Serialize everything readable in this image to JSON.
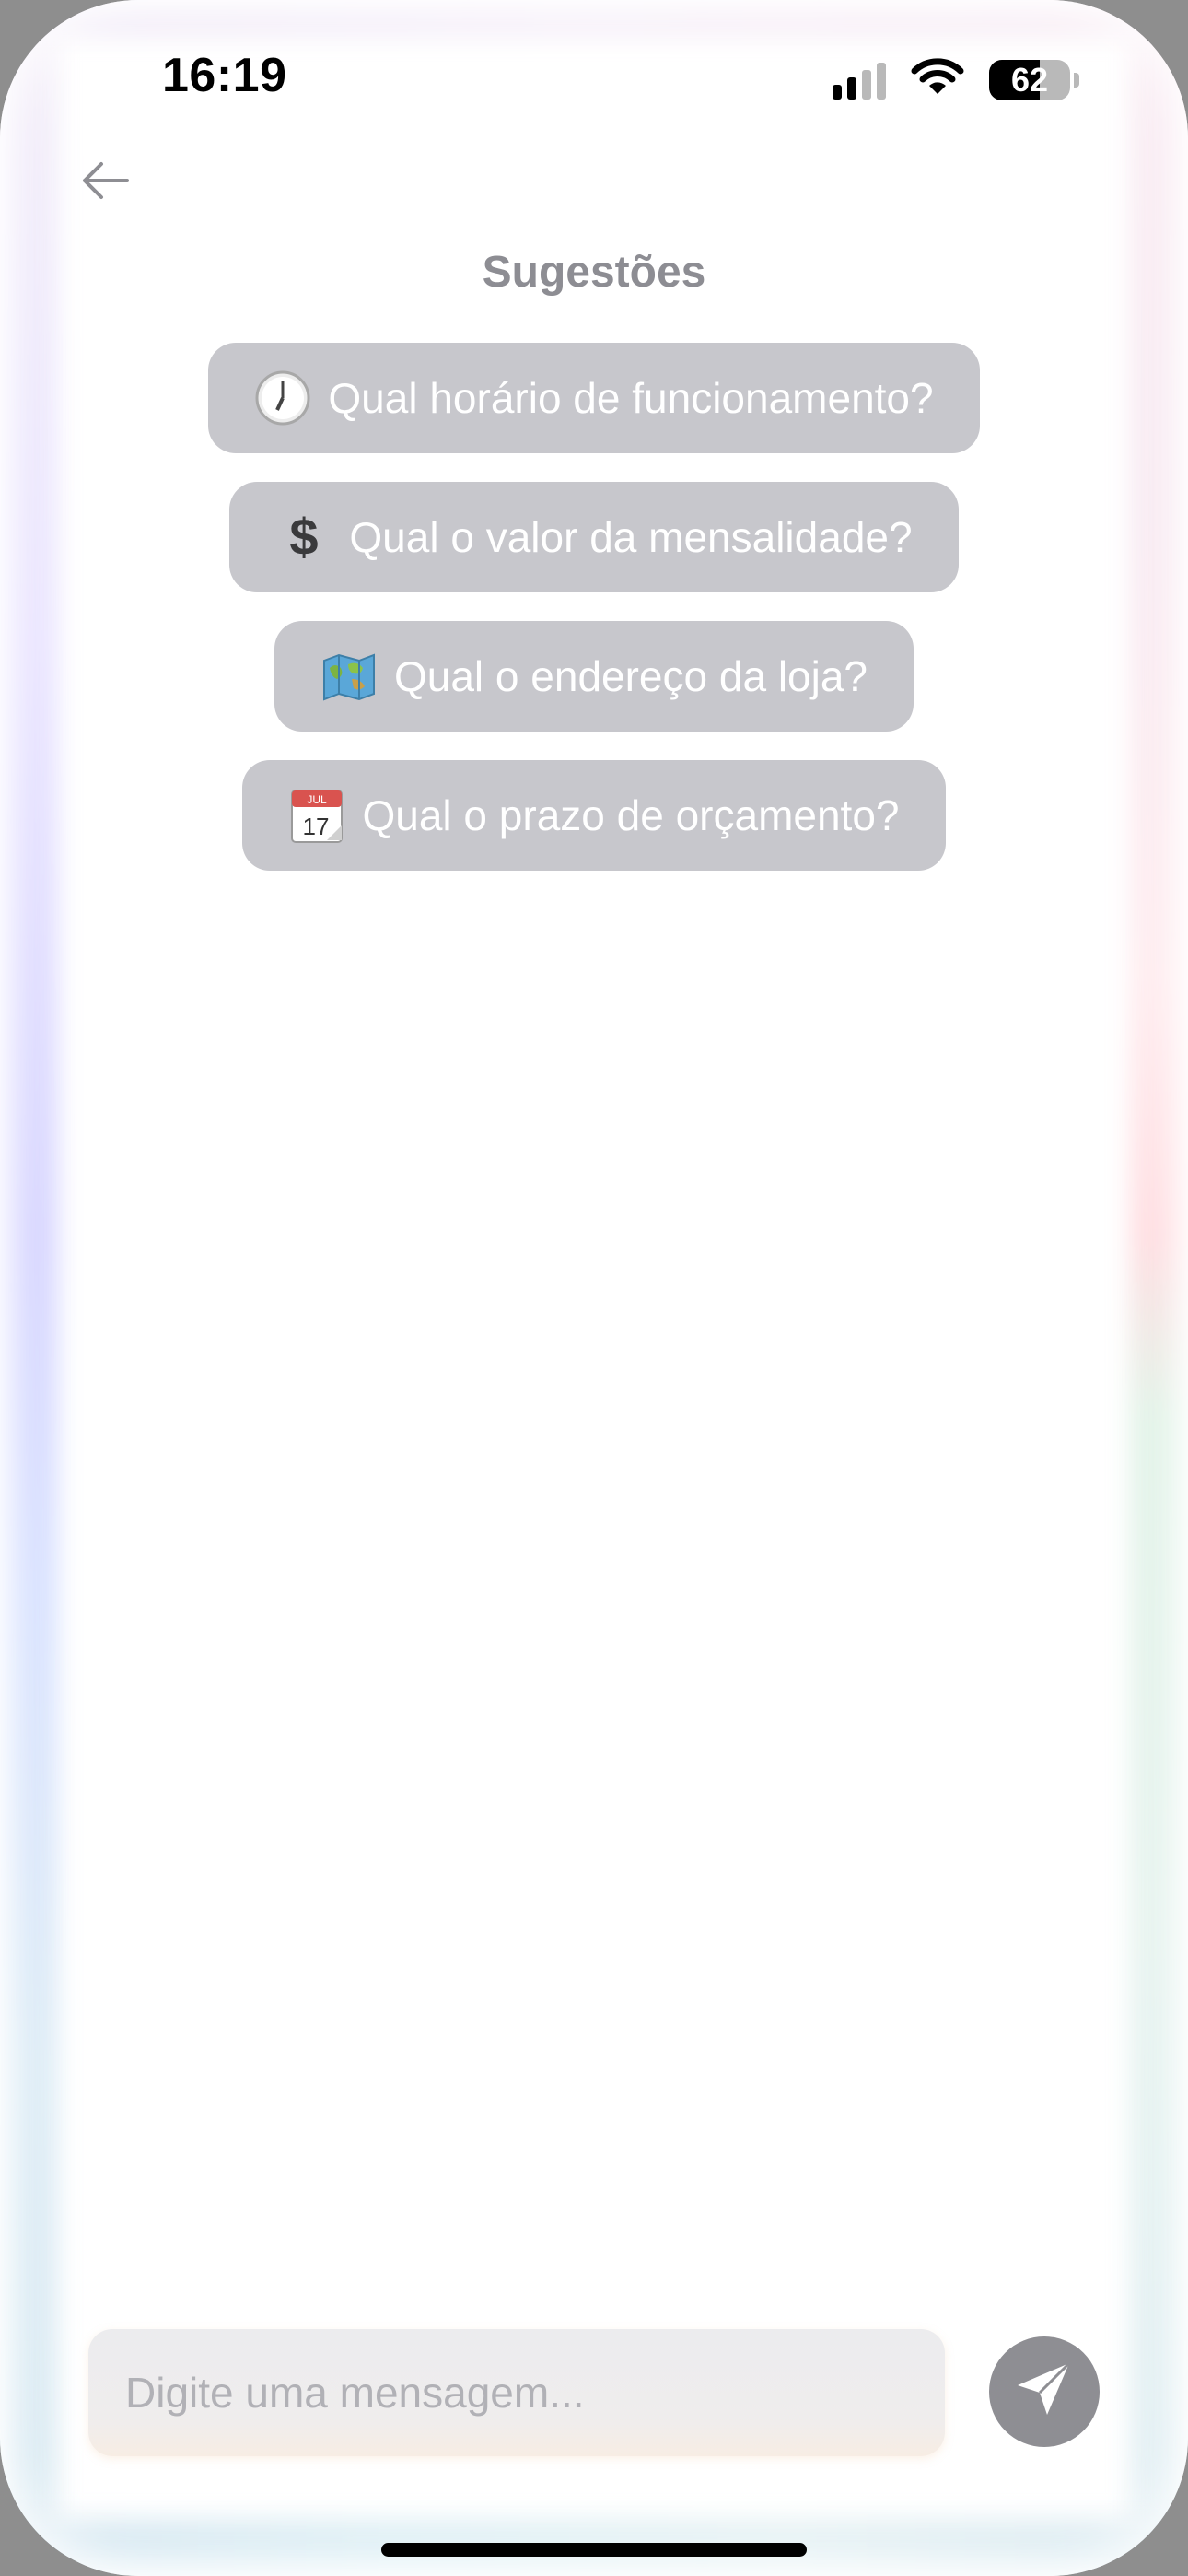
{
  "status_bar": {
    "time": "16:19",
    "battery_percent": "62",
    "battery_level": 0.62,
    "signal_bars_active": 2,
    "icons": [
      "signal-icon",
      "wifi-icon",
      "battery-icon"
    ]
  },
  "header": {
    "back_icon": "arrow-left-icon",
    "title": "Sugestões"
  },
  "suggestions": [
    {
      "icon": "clock-icon",
      "label": "Qual horário de funcionamento?"
    },
    {
      "icon": "dollar-icon",
      "label": "Qual o valor da mensalidade?"
    },
    {
      "icon": "map-icon",
      "label": "Qual o endereço da loja?"
    },
    {
      "icon": "calendar-icon",
      "label": "Qual o prazo de orçamento?",
      "calendar_month": "JUL",
      "calendar_day": "17"
    }
  ],
  "composer": {
    "placeholder": "Digite uma mensagem...",
    "value": "",
    "send_icon": "paper-plane-icon"
  },
  "colors": {
    "chip_bg": "#c7c7cc",
    "title": "#8d8d93",
    "send_bg": "#8e8e93"
  }
}
